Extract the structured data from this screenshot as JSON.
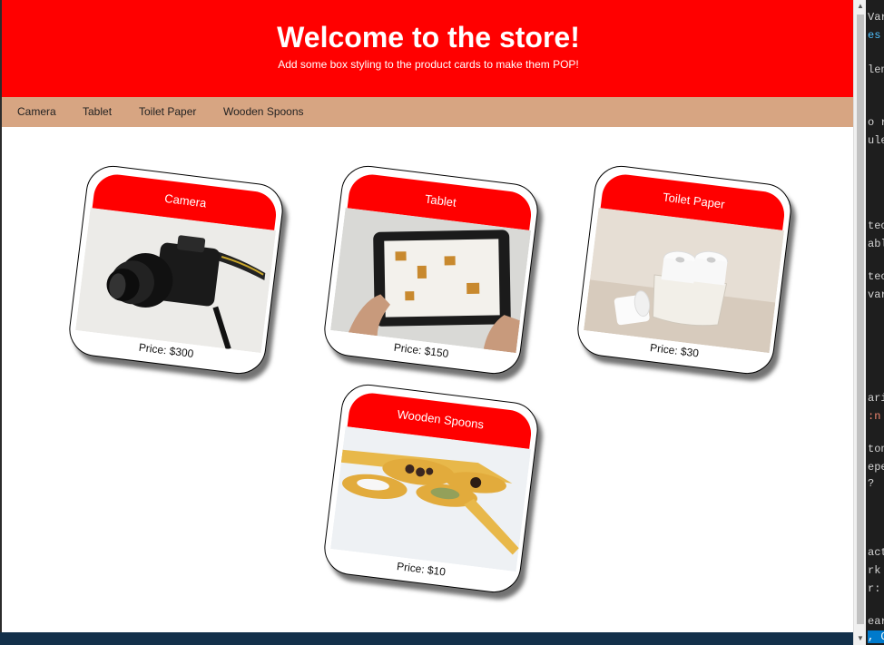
{
  "header": {
    "title": "Welcome to the store!",
    "subtitle": "Add some box styling to the product cards to make them POP!"
  },
  "nav": {
    "items": [
      "Camera",
      "Tablet",
      "Toilet Paper",
      "Wooden Spoons"
    ]
  },
  "products": [
    {
      "name": "Camera",
      "price": "Price: $300"
    },
    {
      "name": "Tablet",
      "price": "Price: $150"
    },
    {
      "name": "Toilet Paper",
      "price": "Price: $30"
    },
    {
      "name": "Wooden Spoons",
      "price": "Price: $10"
    }
  ],
  "editor_lines": [
    "Var",
    "es",
    "len",
    "o r",
    "ule",
    "tec",
    "abl",
    "tec",
    "var",
    "ari",
    ":n",
    "ton",
    "epe",
    "?",
    "act",
    "rk",
    "r:",
    "ear",
    ", Co"
  ],
  "colors": {
    "header_bg": "#ff0000",
    "nav_bg": "#d7a582",
    "card_title_bg": "#ff0000"
  }
}
